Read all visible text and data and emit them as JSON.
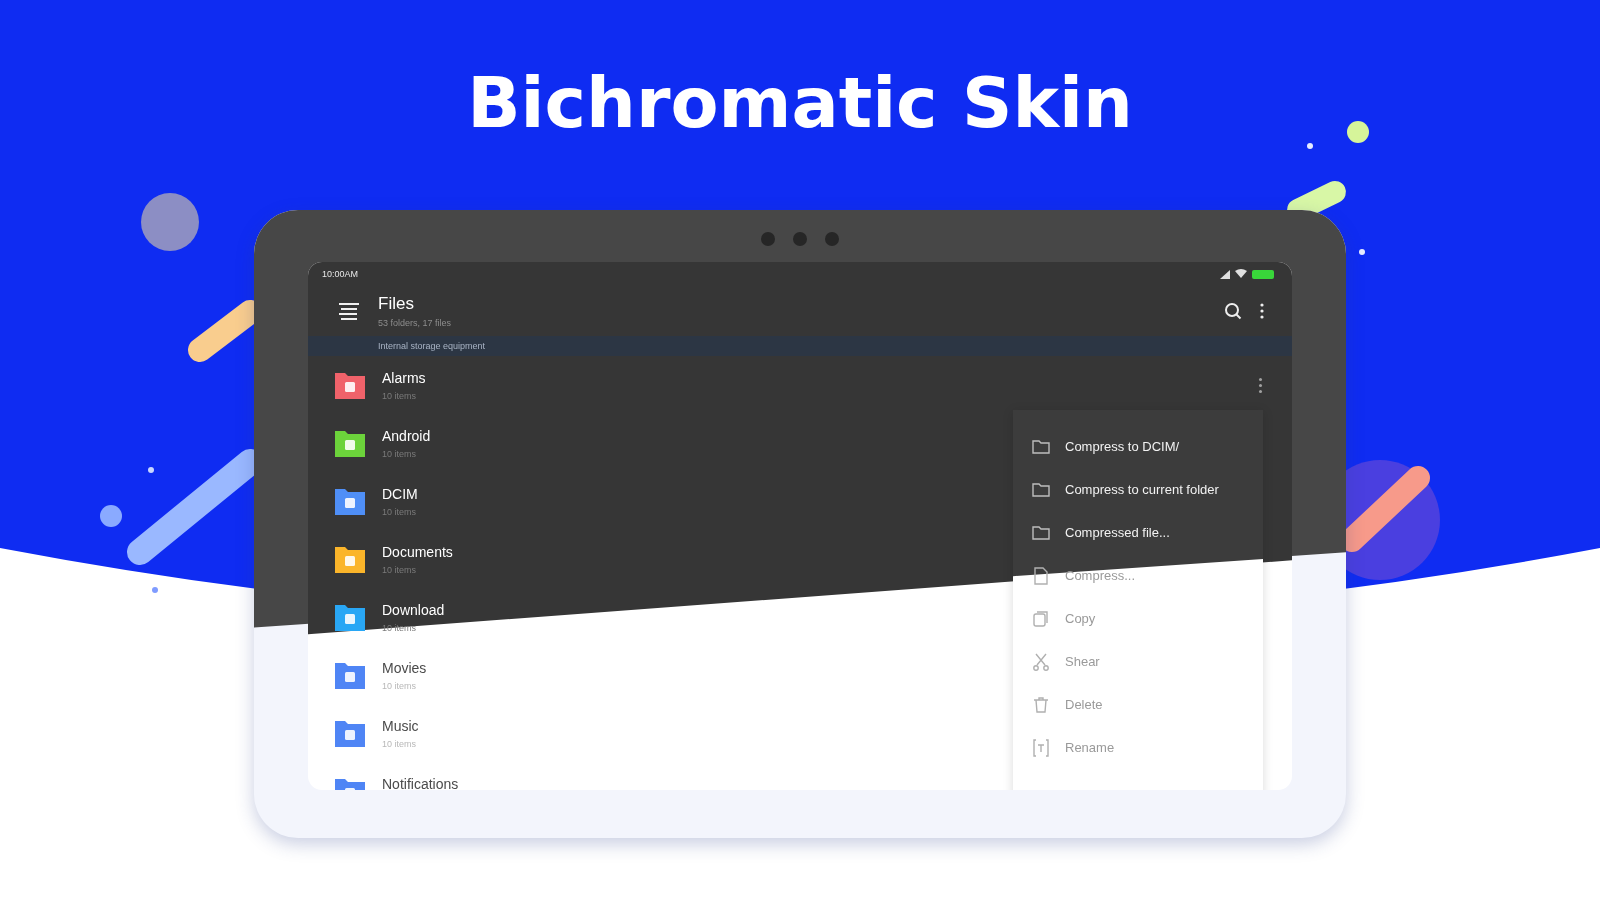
{
  "headline": "Bichromatic Skin",
  "status_bar": {
    "time": "10:00AM"
  },
  "app_bar": {
    "title": "Files",
    "subtitle": "53 folders, 17 files"
  },
  "path_bar": {
    "path": "Internal storage equipment"
  },
  "files": [
    {
      "name": "Alarms",
      "detail": "10 items",
      "color": "#f0626a",
      "dark": true,
      "menu_open": true
    },
    {
      "name": "Android",
      "detail": "10 items",
      "color": "#6cd33b",
      "dark": true,
      "menu_open": false
    },
    {
      "name": "DCIM",
      "detail": "10 items",
      "color": "#4f8ff7",
      "dark": true,
      "menu_open": false
    },
    {
      "name": "Documents",
      "detail": "10 items",
      "color": "#fbb52a",
      "dark": true,
      "menu_open": false
    },
    {
      "name": "Download",
      "detail": "10 items",
      "color": "#29a7f5",
      "dark": true,
      "menu_open": false
    },
    {
      "name": "Movies",
      "detail": "10 items",
      "color": "#4f85f5",
      "dark": false,
      "menu_open": false
    },
    {
      "name": "Music",
      "detail": "10 items",
      "color": "#4f85f5",
      "dark": false,
      "menu_open": false
    },
    {
      "name": "Notifications",
      "color": "#4f85f5",
      "dark": false,
      "menu_open": false
    }
  ],
  "context_menu": [
    {
      "label": "Compress to DCIM/",
      "kind": "folder",
      "dark": true
    },
    {
      "label": "Compress to current folder",
      "kind": "folder",
      "dark": true
    },
    {
      "label": "Compressed file...",
      "kind": "folder",
      "dark": true
    },
    {
      "label": "Compress...",
      "kind": "file",
      "dark": false
    },
    {
      "label": "Copy",
      "kind": "copy",
      "dark": false
    },
    {
      "label": "Shear",
      "kind": "cut",
      "dark": false
    },
    {
      "label": "Delete",
      "kind": "delete",
      "dark": false
    },
    {
      "label": "Rename",
      "kind": "rename",
      "dark": false
    }
  ]
}
